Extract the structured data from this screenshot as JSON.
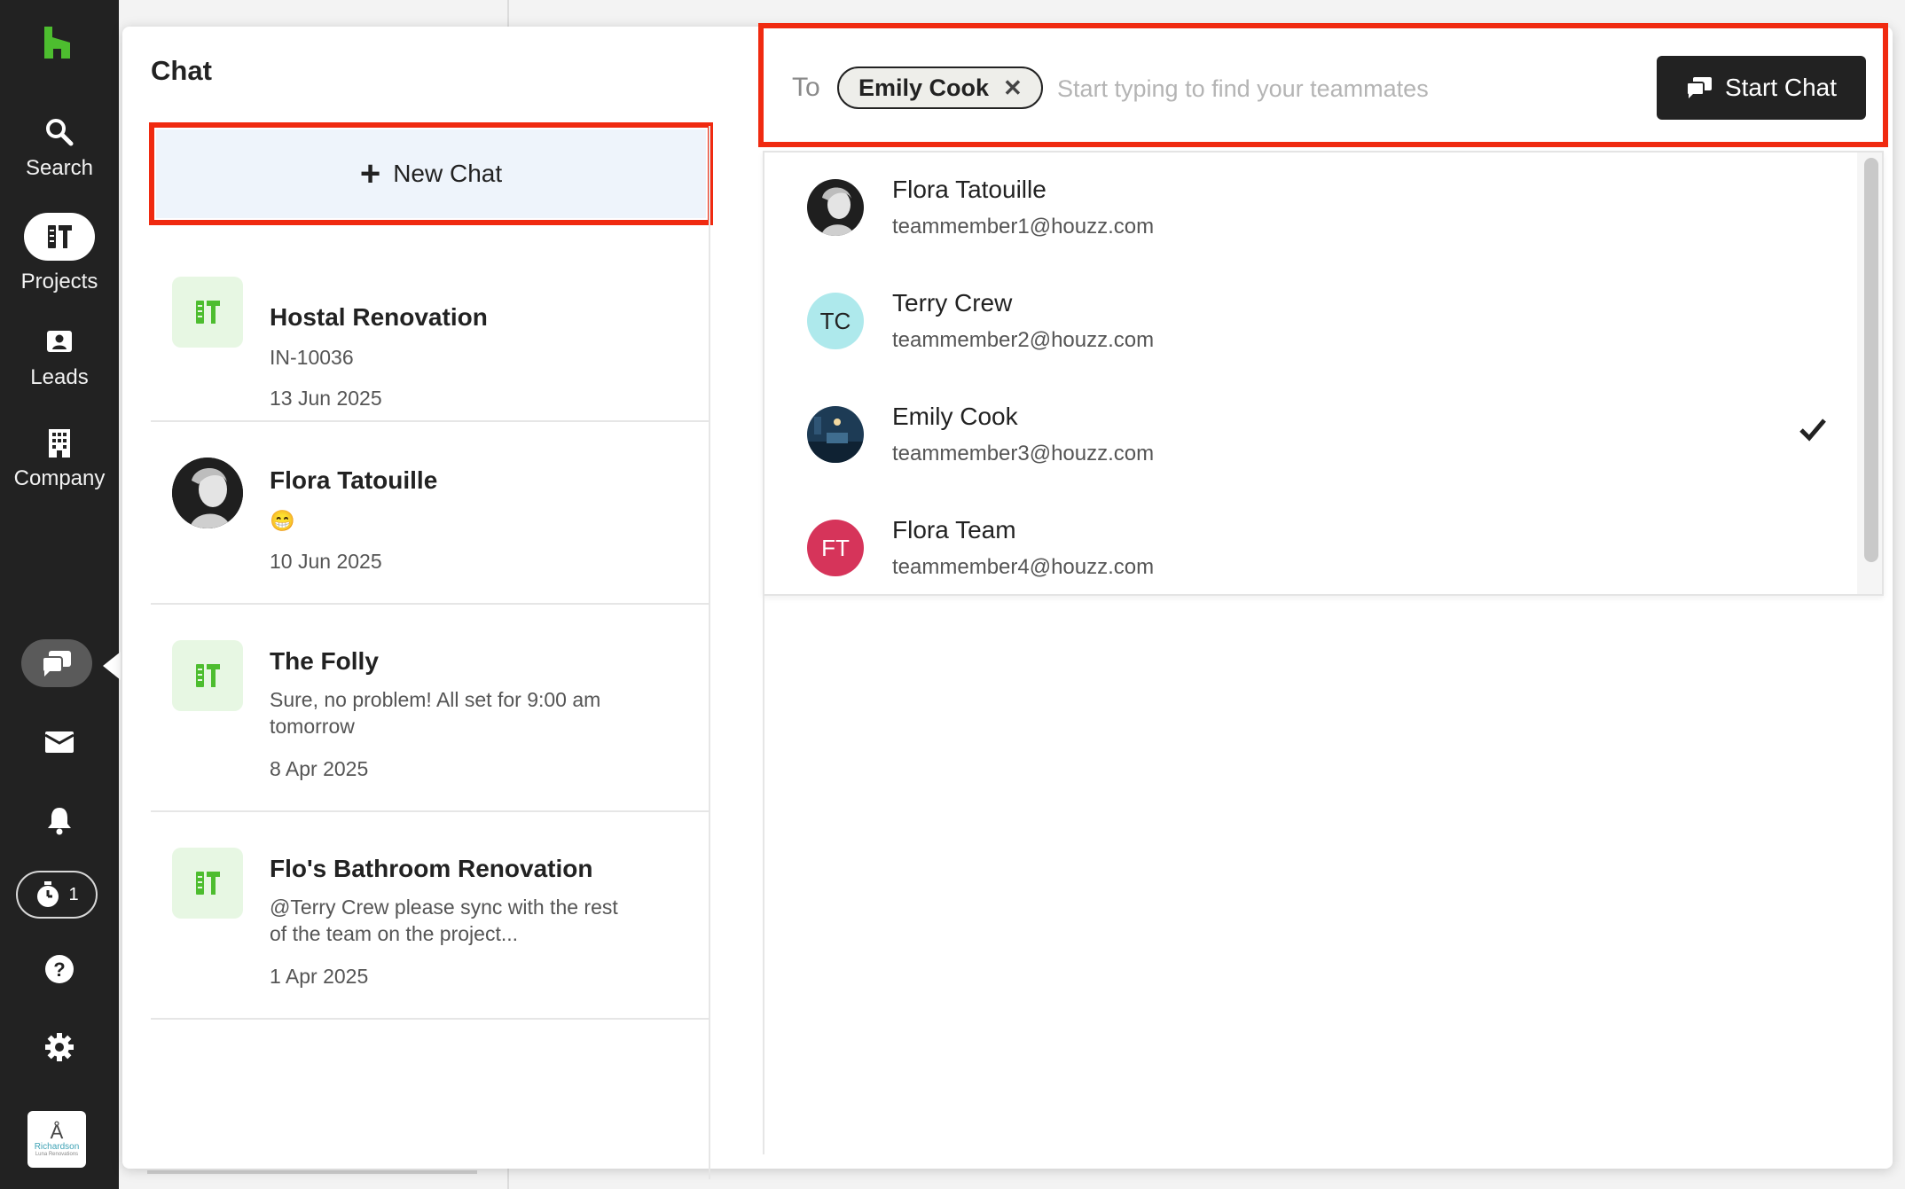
{
  "nav": {
    "items": [
      {
        "label": "Search",
        "icon": "search-icon"
      },
      {
        "label": "Projects",
        "icon": "projects-icon"
      },
      {
        "label": "Leads",
        "icon": "leads-icon"
      },
      {
        "label": "Company",
        "icon": "company-icon"
      }
    ],
    "timer_count": "1",
    "company_logo_text": "Richardson",
    "company_logo_sub": "Luna Renovations"
  },
  "panel": {
    "title": "Chat",
    "new_chat_label": "New Chat"
  },
  "conversations": [
    {
      "name": "Hostal Renovation",
      "subtitle": "IN-10036",
      "date": "13 Jun 2025",
      "thumb": "project"
    },
    {
      "name": "Flora Tatouille",
      "subtitle": "😁",
      "date": "10 Jun 2025",
      "thumb": "avatar"
    },
    {
      "name": "The Folly",
      "subtitle": "Sure, no problem! All set for 9:00 am tomorrow",
      "date": "8 Apr 2025",
      "thumb": "project"
    },
    {
      "name": "Flo's Bathroom Renovation",
      "subtitle": "@Terry Crew please sync with the rest of the team on the project...",
      "date": "1 Apr 2025",
      "thumb": "project"
    }
  ],
  "recipient": {
    "to_label": "To",
    "chip_label": "Emily Cook",
    "input_placeholder": "Start typing to find your teammates",
    "start_chat_label": "Start Chat"
  },
  "teammates": [
    {
      "name": "Flora Tatouille",
      "email": "teammember1@houzz.com",
      "avatar": "photo",
      "initials": "",
      "color": "#2b2b2b",
      "selected": false
    },
    {
      "name": "Terry Crew",
      "email": "teammember2@houzz.com",
      "avatar": "initials",
      "initials": "TC",
      "color": "#aee9ec",
      "selected": false
    },
    {
      "name": "Emily Cook",
      "email": "teammember3@houzz.com",
      "avatar": "photo",
      "initials": "",
      "color": "#1d3b55",
      "selected": true
    },
    {
      "name": "Flora Team",
      "email": "teammember4@houzz.com",
      "avatar": "initials",
      "initials": "FT",
      "color": "#d6345a",
      "selected": false
    }
  ],
  "colors": {
    "rail_bg": "#222222",
    "accent_green": "#4dbd2f",
    "highlight_red": "#f02a10",
    "new_chat_bg": "#eef4fb",
    "project_thumb_bg": "#e7f7e3"
  }
}
